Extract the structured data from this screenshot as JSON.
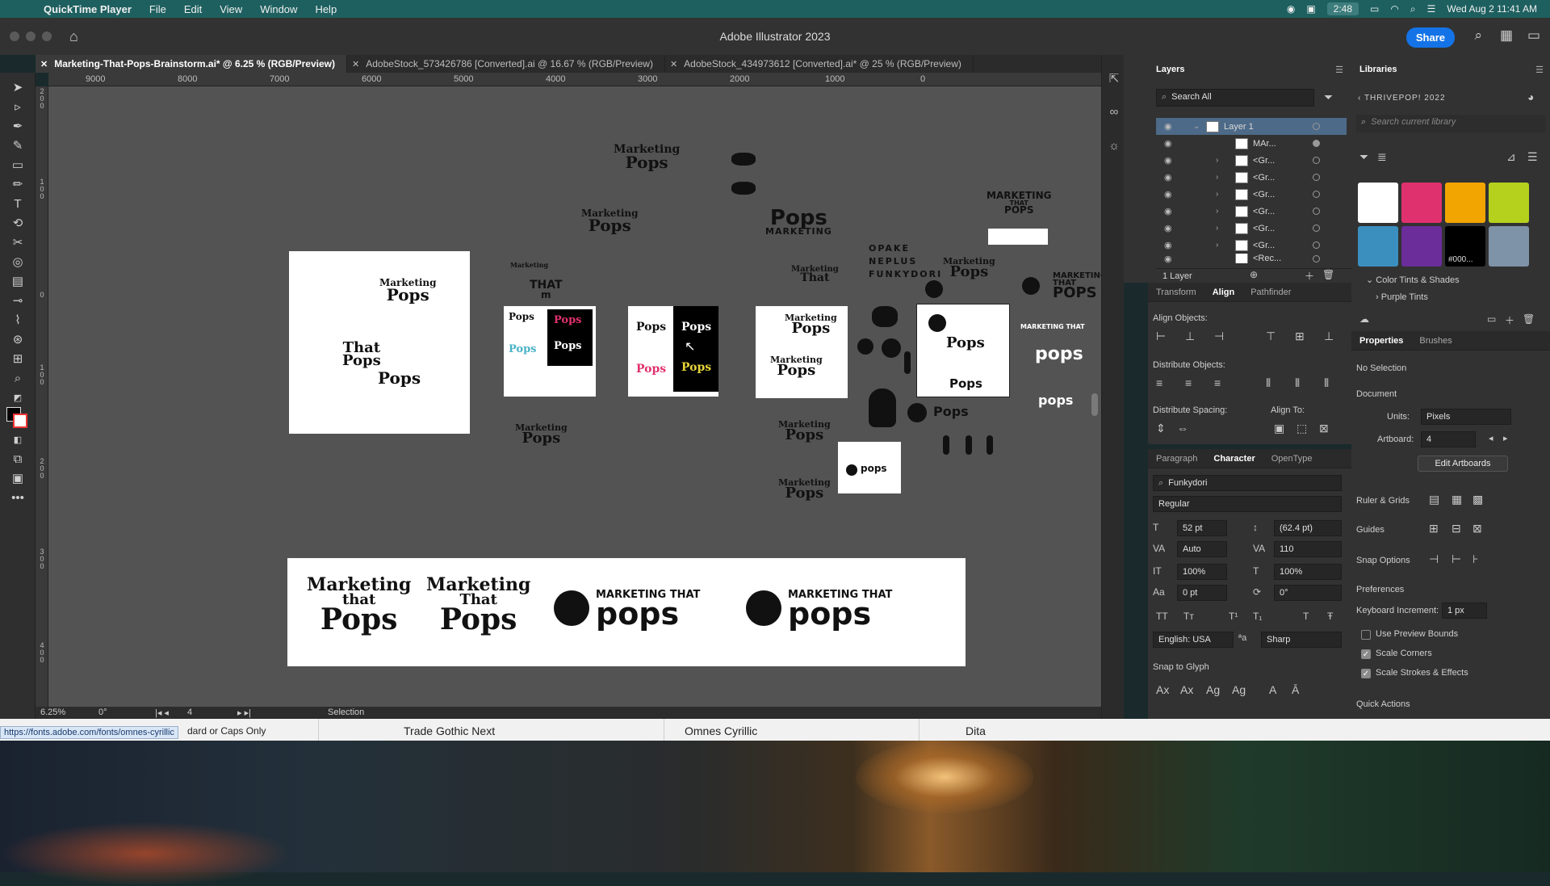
{
  "menubar": {
    "app": "QuickTime Player",
    "items": [
      "File",
      "Edit",
      "View",
      "Window",
      "Help"
    ],
    "time_badge": "2:48",
    "datetime": "Wed Aug 2  11:41 AM"
  },
  "window": {
    "title": "Adobe Illustrator 2023",
    "share_label": "Share"
  },
  "tabs": [
    {
      "label": "Marketing-That-Pops-Brainstorm.ai* @ 6.25 % (RGB/Preview)",
      "active": true
    },
    {
      "label": "AdobeStock_573426786 [Converted].ai @ 16.67 % (RGB/Preview)",
      "active": false
    },
    {
      "label": "AdobeStock_434973612 [Converted].ai* @ 25 % (RGB/Preview)",
      "active": false
    }
  ],
  "ruler": {
    "h_labels": [
      "9000",
      "8000",
      "7000",
      "6000",
      "5000",
      "4000",
      "3000",
      "2000",
      "1000",
      "0"
    ],
    "v_labels": [
      "2\n0\n0",
      "1\n0\n0",
      "0",
      "1\n0\n0",
      "2\n0\n0",
      "3\n0\n0",
      "4\n0\n0"
    ]
  },
  "canvas": {
    "logo_text": {
      "marketing": "Marketing",
      "that": "That",
      "pops": "Pops",
      "that_upper": "THAT",
      "marketing_upper": "MARKETING",
      "pops_upper": "POPS",
      "marketing_that": "MARKETING THAT",
      "pops_lower": "pops",
      "m": "m",
      "font_specimen": [
        "OPAKE",
        "NEPLUS",
        "FUNKYDORI"
      ]
    },
    "banner_logos": [
      {
        "line1": "Marketing",
        "line2": "Pops",
        "line_mid": "that"
      },
      {
        "line1": "Marketing",
        "line2": "Pops",
        "line_mid": "That"
      },
      {
        "line1": "MARKETING THAT",
        "line2": "pops"
      },
      {
        "line1": "MARKETING THAT",
        "line2": "pops"
      }
    ]
  },
  "statusbar": {
    "zoom": "6.25%",
    "rotation": "0°",
    "artboard": "4",
    "tool": "Selection"
  },
  "layers": {
    "title": "Layers",
    "search_placeholder": "Search All",
    "rows": [
      {
        "name": "Layer 1",
        "selected": true
      },
      {
        "name": "MAr..."
      },
      {
        "name": "<Gr..."
      },
      {
        "name": "<Gr..."
      },
      {
        "name": "<Gr..."
      },
      {
        "name": "<Gr..."
      },
      {
        "name": "<Gr..."
      },
      {
        "name": "<Gr..."
      },
      {
        "name": "<Rec..."
      }
    ],
    "footer": "1 Layer"
  },
  "align": {
    "tabs": [
      "Transform",
      "Align",
      "Pathfinder"
    ],
    "align_objects": "Align Objects:",
    "distribute_objects": "Distribute Objects:",
    "distribute_spacing": "Distribute Spacing:",
    "align_to": "Align To:"
  },
  "character": {
    "tabs": [
      "Paragraph",
      "Character",
      "OpenType"
    ],
    "font": "Funkydori",
    "style": "Regular",
    "size": "52 pt",
    "leading": "(62.4 pt)",
    "kerning": "Auto",
    "tracking": "110",
    "vscale": "100%",
    "hscale": "100%",
    "baseline": "0 pt",
    "rotation": "0°",
    "language": "English: USA",
    "aa": "Sharp",
    "snap_to_glyph": "Snap to Glyph"
  },
  "libraries": {
    "title": "Libraries",
    "library_name": "THRIVEPOP! 2022",
    "search_placeholder": "Search current library",
    "swatches": [
      "#ffffff",
      "#e0316f",
      "#f2a400",
      "#b5d11e",
      "#3b8fbf",
      "#6a2d9a",
      "#000000",
      "#7f93a8"
    ],
    "swatch_label": "#000...",
    "groups": [
      "Color Tints & Shades",
      "Purple Tints"
    ]
  },
  "properties": {
    "tabs": [
      "Properties",
      "Brushes"
    ],
    "selection": "No Selection",
    "document": "Document",
    "units_label": "Units:",
    "units": "Pixels",
    "artboard_label": "Artboard:",
    "artboard": "4",
    "edit_artboards": "Edit Artboards",
    "ruler_grids": "Ruler & Grids",
    "guides": "Guides",
    "snap_options": "Snap Options",
    "preferences": "Preferences",
    "keyboard_increment_label": "Keyboard Increment:",
    "keyboard_increment": "1 px",
    "checkboxes": [
      {
        "label": "Use Preview Bounds",
        "checked": false
      },
      {
        "label": "Scale Corners",
        "checked": true
      },
      {
        "label": "Scale Strokes & Effects",
        "checked": true
      }
    ],
    "quick_actions": "Quick Actions"
  },
  "browser": {
    "url_hint": "https://fonts.adobe.com/fonts/omnes-cyrillic",
    "fonts": [
      "dard or Caps Only",
      "Trade Gothic Next",
      "Omnes Cyrillic",
      "Dita"
    ]
  }
}
